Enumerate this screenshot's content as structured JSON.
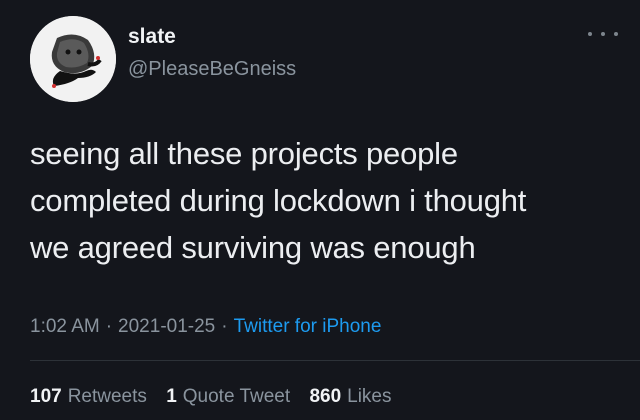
{
  "author": {
    "display_name": "slate",
    "handle": "@PleaseBeGneiss",
    "avatar_icon": "rock-avatar-icon"
  },
  "more_icon": "ellipsis-icon",
  "tweet": {
    "text": "seeing all these projects people\ncompleted during lockdown i thought\nwe agreed surviving was enough"
  },
  "meta": {
    "time": "1:02 AM",
    "separator": "·",
    "date": "2021-01-25",
    "source": "Twitter for iPhone"
  },
  "stats": {
    "retweets_count": "107",
    "retweets_label": "Retweets",
    "quotes_count": "1",
    "quotes_label": "Quote Tweet",
    "likes_count": "860",
    "likes_label": "Likes"
  },
  "colors": {
    "background": "#14161c",
    "link": "#1d9bf0",
    "secondary_text": "#8a949e"
  }
}
